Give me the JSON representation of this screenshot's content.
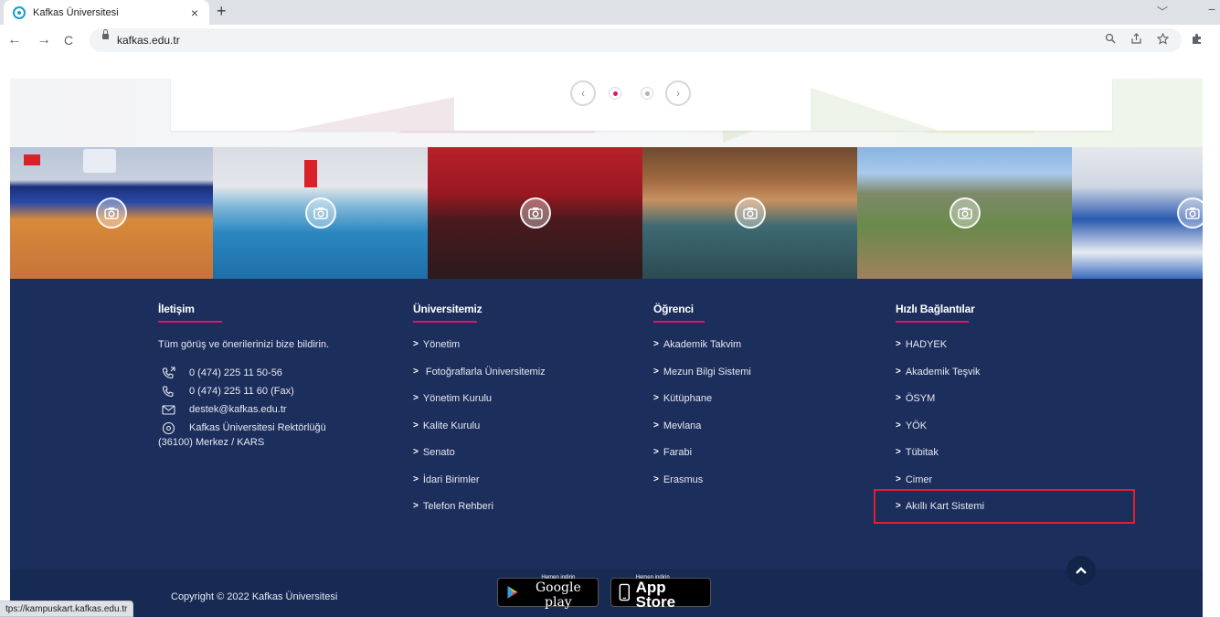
{
  "browser": {
    "tab_title": "Kafkas Üniversitesi",
    "tab_close": "×",
    "new_tab": "+",
    "tab_dropdown": "﹀",
    "minimize": "−",
    "back": "←",
    "forward": "→",
    "reload": "C",
    "url": "kafkas.edu.tr",
    "status_url": "tps://kampuskart.kafkas.edu.tr"
  },
  "slider": {
    "prev": "‹",
    "next": "›"
  },
  "gallery": {
    "photos": [
      {
        "name": "sports-hall"
      },
      {
        "name": "swimming-pool"
      },
      {
        "name": "graduation"
      },
      {
        "name": "conference-hall"
      },
      {
        "name": "campus-aerial"
      },
      {
        "name": "laboratory"
      }
    ]
  },
  "footer": {
    "contact": {
      "title": "İletişim",
      "intro": "Tüm görüş ve önerilerinizi bize bildirin.",
      "phone": "0 (474) 225 11 50-56",
      "fax": "0 (474) 225 11 60 (Fax)",
      "email": "destek@kafkas.edu.tr",
      "address1": "Kafkas Üniversitesi Rektörlüğü",
      "address2": "(36100) Merkez / KARS"
    },
    "university": {
      "title": "Üniversitemiz",
      "items": [
        "Yönetim",
        "Fotoğraflarla Üniversitemiz",
        "Yönetim Kurulu",
        "Kalite Kurulu",
        "Senato",
        "İdari Birimler",
        "Telefon Rehberi"
      ]
    },
    "student": {
      "title": "Öğrenci",
      "items": [
        "Akademik Takvim",
        "Mezun Bilgi Sistemi",
        "Kütüphane",
        "Mevlana",
        "Farabi",
        "Erasmus"
      ]
    },
    "quick_links": {
      "title": "Hızlı Bağlantılar",
      "items": [
        "HADYEK",
        "Akademik Teşvik",
        "ÖSYM",
        "YÖK",
        "Tübitak",
        "Cimer",
        "Akıllı Kart Sistemi"
      ]
    },
    "copyright": "Copyright © 2022 Kafkas Üniversitesi",
    "google_play": {
      "small": "Hemen indirin",
      "big": "Google play"
    },
    "app_store": {
      "small": "Hemen indirin",
      "big": "App Store"
    }
  },
  "colors": {
    "footer_bg": "#1c2e5b",
    "accent": "#e3126f",
    "highlight_box": "#e0202e"
  }
}
